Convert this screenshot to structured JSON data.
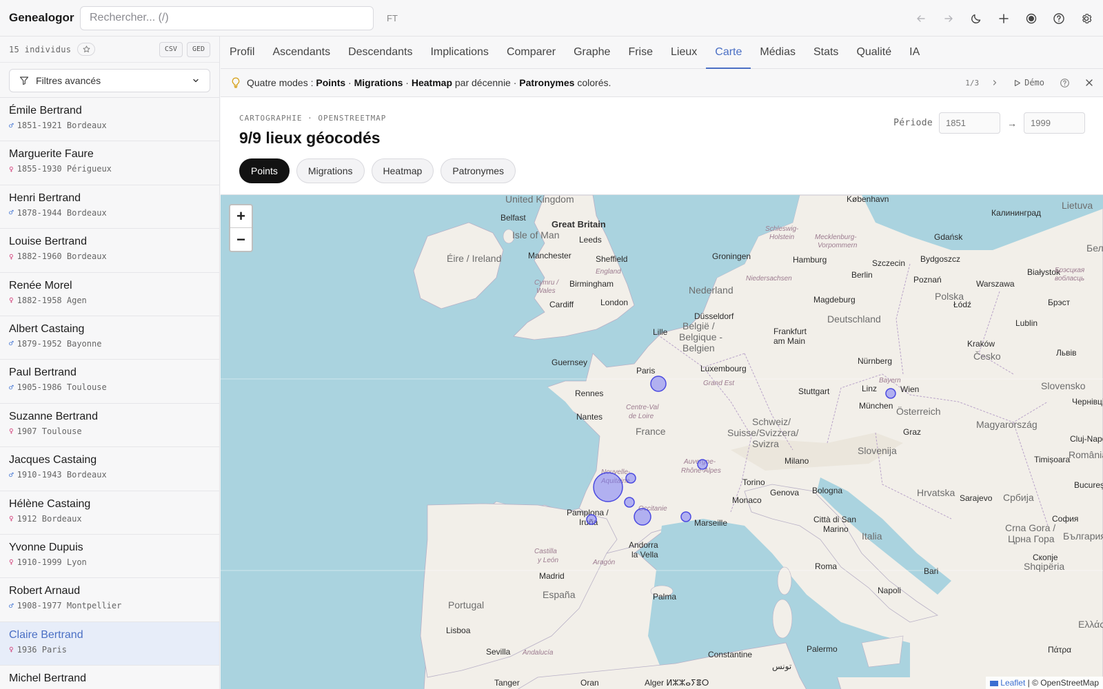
{
  "app": {
    "title": "Genealogor"
  },
  "search": {
    "placeholder": "Rechercher... (/)"
  },
  "top": {
    "ft_label": "FT"
  },
  "sidebar": {
    "count": "15 individus",
    "csv_label": "CSV",
    "ged_label": "GED",
    "filters_label": "Filtres avancés",
    "people": [
      {
        "name": "Émile Bertrand",
        "sex": "♂",
        "meta": "1851-1921 Bordeaux"
      },
      {
        "name": "Marguerite Faure",
        "sex": "♀",
        "meta": "1855-1930 Périgueux"
      },
      {
        "name": "Henri Bertrand",
        "sex": "♂",
        "meta": "1878-1944 Bordeaux"
      },
      {
        "name": "Louise Bertrand",
        "sex": "♀",
        "meta": "1882-1960 Bordeaux"
      },
      {
        "name": "Renée Morel",
        "sex": "♀",
        "meta": "1882-1958 Agen"
      },
      {
        "name": "Albert Castaing",
        "sex": "♂",
        "meta": "1879-1952 Bayonne"
      },
      {
        "name": "Paul Bertrand",
        "sex": "♂",
        "meta": "1905-1986 Toulouse"
      },
      {
        "name": "Suzanne Bertrand",
        "sex": "♀",
        "meta": "1907 Toulouse"
      },
      {
        "name": "Jacques Castaing",
        "sex": "♂",
        "meta": "1910-1943 Bordeaux"
      },
      {
        "name": "Hélène Castaing",
        "sex": "♀",
        "meta": "1912 Bordeaux"
      },
      {
        "name": "Yvonne Dupuis",
        "sex": "♀",
        "meta": "1910-1999 Lyon"
      },
      {
        "name": "Robert Arnaud",
        "sex": "♂",
        "meta": "1908-1977 Montpellier"
      },
      {
        "name": "Claire Bertrand",
        "sex": "♀",
        "meta": "1936 Paris"
      },
      {
        "name": "Michel Bertrand",
        "sex": "♂",
        "meta": ""
      }
    ]
  },
  "tabs": [
    "Profil",
    "Ascendants",
    "Descendants",
    "Implications",
    "Comparer",
    "Graphe",
    "Frise",
    "Lieux",
    "Carte",
    "Médias",
    "Stats",
    "Qualité",
    "IA"
  ],
  "tip": {
    "intro": "Quatre modes : ",
    "m1": "Points",
    "sep": " · ",
    "m2": "Migrations",
    "m3": "Heatmap",
    "mid": " par décennie · ",
    "m4": "Patronymes",
    "end": " colorés.",
    "pager": "1/3",
    "demo": "Démo"
  },
  "map_header": {
    "kicker": "CARTOGRAPHIE · OPENSTREETMAP",
    "title": "9/9 lieux géocodés",
    "modes": [
      "Points",
      "Migrations",
      "Heatmap",
      "Patronymes"
    ],
    "period_label": "Période",
    "period_from": "1851",
    "period_to": "1999"
  },
  "map": {
    "zoom_in": "+",
    "zoom_out": "−",
    "attrib_link": "Leaflet",
    "attrib_text": " | © OpenStreetMap",
    "labels": {
      "uk": "United Kingdom",
      "gb": "Great Britain",
      "ireland": "Éire / Ireland",
      "isle_man": "Isle of Man",
      "belfast": "Belfast",
      "leeds": "Leeds",
      "manchester": "Manchester",
      "sheffield": "Sheffield",
      "england": "England",
      "birmingham": "Birmingham",
      "cymru": "Cymru /",
      "wales": "Wales",
      "cardiff": "Cardiff",
      "london": "London",
      "guernsey": "Guernsey",
      "rennes": "Rennes",
      "nantes": "Nantes",
      "paris": "Paris",
      "lille": "Lille",
      "france": "France",
      "centre": "Centre-Val",
      "de_loire": "de Loire",
      "nouvelle": "Nouvelle-",
      "aquitaine": "Aquitaine",
      "occitanie": "Occitanie",
      "auvergne": "Auvergne-",
      "rhone": "Rhône-Alpes",
      "marseille": "Marseille",
      "monaco": "Monaco",
      "pamplona": "Pamplona /",
      "irunea": "Iruña",
      "andorra": "Andorra",
      "la_vella": "la Vella",
      "castilla": "Castilla",
      "y_leon": "y León",
      "aragon": "Aragón",
      "madrid": "Madrid",
      "espana": "España",
      "portugal": "Portugal",
      "lisboa": "Lisboa",
      "sevilla": "Sevilla",
      "andalucia": "Andalucía",
      "palma": "Palma",
      "tanger": "Tanger",
      "oran": "Oran",
      "alger": "Alger ⵍⵣⵣⴰⵢⴻⵔ",
      "constantine": "Constantine",
      "tunis": "تونس",
      "palermo": "Palermo",
      "roma": "Roma",
      "napoli": "Napoli",
      "bari": "Bari",
      "citta": "Città di San",
      "marino": "Marino",
      "bologna": "Bologna",
      "genova": "Genova",
      "milano": "Milano",
      "torino": "Torino",
      "italia": "Italia",
      "nederland": "Nederland",
      "groningen": "Groningen",
      "dusseldorf": "Düsseldorf",
      "belgie": "België /",
      "belgique": "Belgique -",
      "belgien": "Belgien",
      "luxembourg": "Luxembourg",
      "grand_est": "Grand Est",
      "frankfurt": "Frankfurt",
      "am_main": "am Main",
      "deutschland": "Deutschland",
      "nurnberg": "Nürnberg",
      "stuttgart": "Stuttgart",
      "munchen": "München",
      "bayern": "Bayern",
      "schweiz": "Schweiz/",
      "suisse": "Suisse/Svizzera/",
      "svizra": "Svizra",
      "osterreich": "Österreich",
      "linz": "Linz",
      "wien": "Wien",
      "graz": "Graz",
      "slovenija": "Slovenija",
      "hrvatska": "Hrvatska",
      "sarajevo": "Sarajevo",
      "srbija": "Србија",
      "crna_gora": "Crna Gora /",
      "crna_gora2": "Црна Гора",
      "shqiperia": "Shqipëria",
      "cesko": "Česko",
      "slovensko": "Slovensko",
      "magyar": "Magyarország",
      "romania": "România",
      "cluj": "Cluj-Napoca",
      "timisoara": "Timișoara",
      "bucuresti": "București",
      "bulgaria": "България",
      "sofia": "София",
      "skopje": "Скопје",
      "ellas": "Ελλάς",
      "patra": "Πάτρα",
      "ellada": "Ελλάδα",
      "polska": "Polska",
      "berlin": "Berlin",
      "szczecin": "Szczecin",
      "poznan": "Poznań",
      "warszawa": "Warszawa",
      "lodz": "Łódź",
      "krakow": "Kraków",
      "lublin": "Lublin",
      "lviv": "Львів",
      "chernivtsi": "Чернівці",
      "bialystok": "Białystok",
      "brest": "Брэст",
      "gdansk": "Gdańsk",
      "bydgoszcz": "Bydgoszcz",
      "kaliningrad": "Калининград",
      "lietuva": "Lietuva",
      "kobenhavn": "København",
      "hamburg": "Hamburg",
      "magdeburg": "Magdeburg",
      "schleswig": "Schleswig-",
      "holstein": "Holstein",
      "mecklenburg": "Mecklenburg-",
      "vorpommern": "Vorpommern",
      "niedersachsen": "Niedersachsen",
      "bresk": "Брэсцкая",
      "voblasc": "вобласць",
      "bela": "Бела"
    }
  }
}
